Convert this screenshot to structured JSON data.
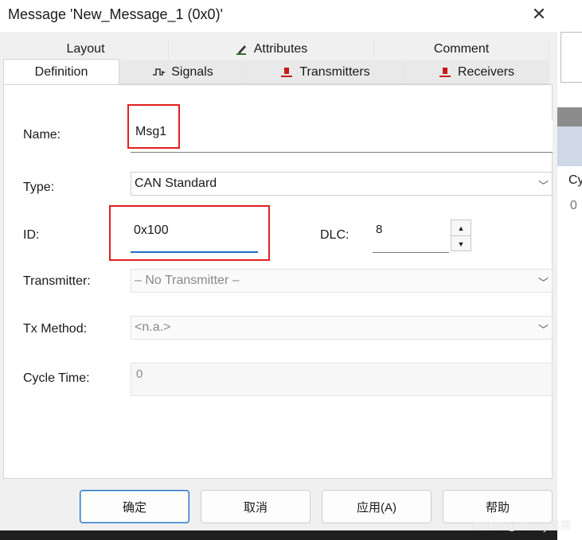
{
  "dialog": {
    "title": "Message 'New_Message_1 (0x0)'",
    "close_glyph": "✕"
  },
  "tabs": {
    "back": [
      {
        "label": "Layout",
        "icon": ""
      },
      {
        "label": "Attributes",
        "icon": "attributes-pencil-icon"
      },
      {
        "label": "Comment",
        "icon": ""
      }
    ],
    "front": [
      {
        "label": "Definition",
        "icon": "",
        "active": true
      },
      {
        "label": "Signals",
        "icon": "signals-icon"
      },
      {
        "label": "Transmitters",
        "icon": "transmitter-node-icon"
      },
      {
        "label": "Receivers",
        "icon": "receiver-node-icon"
      }
    ]
  },
  "form": {
    "name_label": "Name:",
    "name_value": "Msg1",
    "type_label": "Type:",
    "type_value": "CAN Standard",
    "id_label": "ID:",
    "id_value": "0x100",
    "dlc_label": "DLC:",
    "dlc_value": "8",
    "transmitter_label": "Transmitter:",
    "transmitter_value": "– No Transmitter –",
    "txmethod_label": "Tx Method:",
    "txmethod_value": "<n.a.>",
    "cycle_label": "Cycle Time:",
    "cycle_value": "0"
  },
  "buttons": {
    "ok": "确定",
    "cancel": "取消",
    "apply": "应用(A)",
    "help": "帮助"
  },
  "background": {
    "column_header": "Cy",
    "cell_value": "0"
  },
  "watermark": {
    "text": "CSDN @Windy温蒂"
  },
  "colors": {
    "highlight": "#e02020",
    "focus": "#1f6fc5"
  }
}
